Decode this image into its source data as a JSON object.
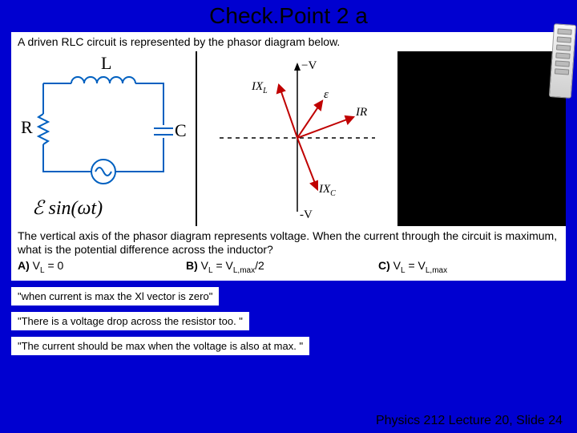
{
  "title": "Check.Point 2 a",
  "intro": "A driven RLC circuit is represented by the phasor diagram below.",
  "circuit": {
    "L": "L",
    "R": "R",
    "C": "C",
    "equation": "ℰ sin(ωt)"
  },
  "phasor": {
    "top": "−V",
    "bottom": "-V",
    "ixl": "IX",
    "ixl_sub": "L",
    "ixc": "IX",
    "ixc_sub": "C",
    "eps": "ε",
    "ir": "IR"
  },
  "question": {
    "text": "The vertical axis of the phasor diagram represents voltage.  When the current through the circuit is maximum, what is the potential difference across the inductor?",
    "a_label": "A)",
    "a_text": " V",
    "a_sub": "L",
    "a_rest": " = 0",
    "b_label": "B)",
    "b_text1": " V",
    "b_sub1": "L",
    "b_text2": " = V",
    "b_sub2": "L,max",
    "b_text3": "/2",
    "c_label": "C)",
    "c_text1": " V",
    "c_sub1": "L",
    "c_text2": " = V",
    "c_sub2": "L,max"
  },
  "quotes": {
    "q1": "\"when current is max the Xl vector is zero\"",
    "q2": "\"There is a voltage drop across the resistor too. \"",
    "q3": "\"The current should be max when the voltage is also at max. \""
  },
  "footer": "Physics 212  Lecture 20, Slide  24"
}
